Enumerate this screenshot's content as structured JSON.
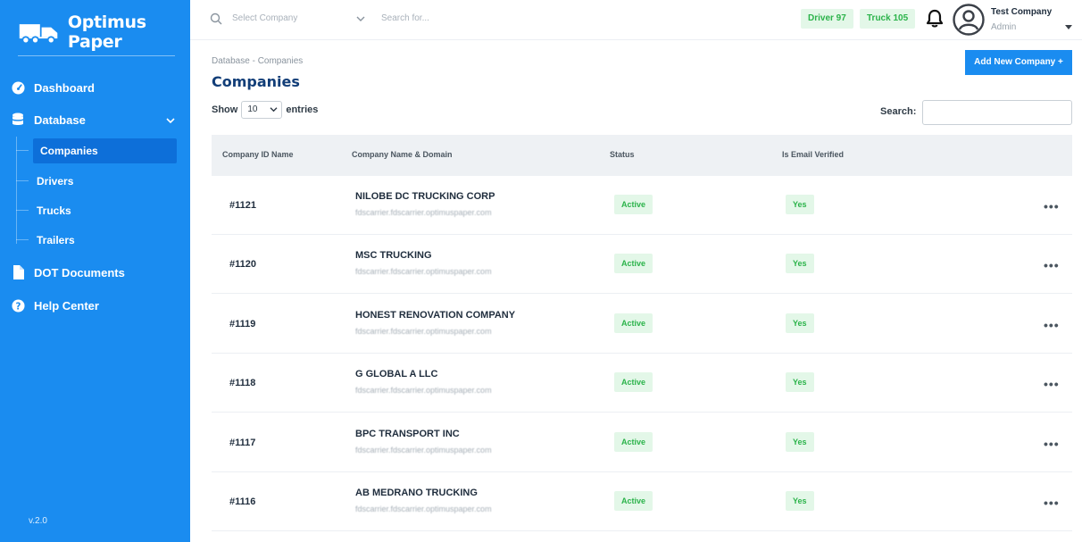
{
  "brand": {
    "name": "Optimus Paper"
  },
  "sidebar": {
    "items": [
      {
        "label": "Dashboard"
      },
      {
        "label": "Database"
      },
      {
        "label": "DOT Documents"
      },
      {
        "label": "Help Center"
      }
    ],
    "sub_items": [
      {
        "label": "Companies"
      },
      {
        "label": "Drivers"
      },
      {
        "label": "Trucks"
      },
      {
        "label": "Trailers"
      }
    ],
    "version": "v.2.0"
  },
  "header": {
    "company_placeholder": "Select Company",
    "search_placeholder": "Search for...",
    "driver_badge": "Driver 97",
    "truck_badge": "Truck 105",
    "user_name": "Test Company",
    "user_role": "Admin"
  },
  "main": {
    "breadcrumb": "Database - Companies",
    "title": "Companies",
    "add_button": "Add New Company +",
    "show_label": "Show",
    "entries_value": "10",
    "entries_label": "entries",
    "search_label": "Search:",
    "columns": [
      "Company ID Name",
      "Company Name & Domain",
      "Status",
      "Is Email Verified"
    ],
    "rows": [
      {
        "id": "#1121",
        "name": "NILOBE DC TRUCKING CORP",
        "domain": "fdscarrier.fdscarrier.optimuspaper.com",
        "status": "Active",
        "verified": "Yes",
        "more": "•••"
      },
      {
        "id": "#1120",
        "name": "MSC TRUCKING",
        "domain": "fdscarrier.fdscarrier.optimuspaper.com",
        "status": "Active",
        "verified": "Yes",
        "more": "•••"
      },
      {
        "id": "#1119",
        "name": "HONEST RENOVATION COMPANY",
        "domain": "fdscarrier.fdscarrier.optimuspaper.com",
        "status": "Active",
        "verified": "Yes",
        "more": "•••"
      },
      {
        "id": "#1118",
        "name": "G GLOBAL A LLC",
        "domain": "fdscarrier.fdscarrier.optimuspaper.com",
        "status": "Active",
        "verified": "Yes",
        "more": "•••"
      },
      {
        "id": "#1117",
        "name": "BPC TRANSPORT INC",
        "domain": "fdscarrier.fdscarrier.optimuspaper.com",
        "status": "Active",
        "verified": "Yes",
        "more": "•••"
      },
      {
        "id": "#1116",
        "name": "AB MEDRANO TRUCKING",
        "domain": "fdscarrier.fdscarrier.optimuspaper.com",
        "status": "Active",
        "verified": "Yes",
        "more": "•••"
      }
    ]
  },
  "colors": {
    "primary": "#1a8cf0",
    "active_nav": "#0d6fd9",
    "title": "#123e78",
    "success_bg": "#e3f7e8",
    "success_text": "#2bb34a"
  }
}
